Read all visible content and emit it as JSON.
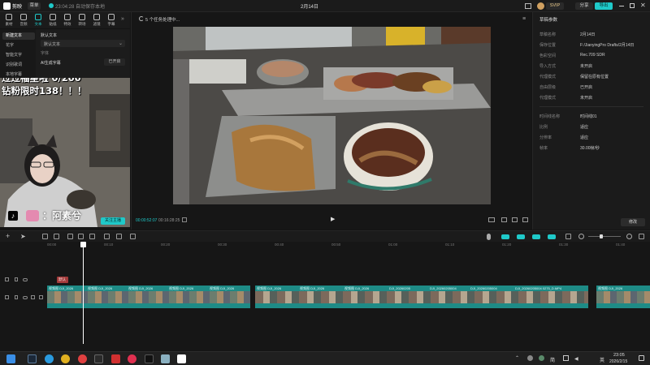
{
  "app": {
    "name": "剪映",
    "menu": "菜单",
    "autosave": "23:04:28 自动保存本地",
    "doc_title": "2月14日",
    "vip_badge": "SVIP",
    "share_label": "分享",
    "export_label": "导出"
  },
  "toolbar": {
    "items": [
      {
        "label": "素材",
        "icon": "media-icon"
      },
      {
        "label": "音频",
        "icon": "audio-icon"
      },
      {
        "label": "文本",
        "icon": "text-icon"
      },
      {
        "label": "贴纸",
        "icon": "sticker-icon"
      },
      {
        "label": "特效",
        "icon": "effects-icon"
      },
      {
        "label": "转场",
        "icon": "transition-icon"
      },
      {
        "label": "滤镜",
        "icon": "filter-icon"
      },
      {
        "label": "字幕",
        "icon": "caption-icon"
      }
    ],
    "active_index": 2
  },
  "sidebar": {
    "items": [
      "新建文本",
      "花字",
      "智能文字",
      "识别歌词",
      "本地字幕"
    ],
    "active_index": 0
  },
  "text_panel": {
    "heading": "默认文本",
    "template_select": "默认文本",
    "font_label": "字体",
    "apply_label": "应用到全部",
    "ai_label": "AI生成字幕",
    "ai_dropdown": "已开启"
  },
  "overlay": {
    "caption_line1": "过过福星啦 0/200",
    "caption_line2": "钻粉限时138！！！",
    "user_name": "：阿素兮",
    "follow_label": "关注主播"
  },
  "player": {
    "task_label": "5 个任务处理中...",
    "current_time": "00:00:52:07",
    "total_time": "00:16:28:25"
  },
  "properties": {
    "title": "草稿参数",
    "rows": [
      {
        "key": "草稿名称",
        "value": "2月14日"
      },
      {
        "key": "保存位置",
        "value": "F:/JianyingPro Drafts/2月14日"
      },
      {
        "key": "色彩空间",
        "value": "Rec.709 SDR"
      },
      {
        "key": "导入方式",
        "value": "未开启"
      },
      {
        "key": "代理模式",
        "value": "保留在原有位置"
      },
      {
        "key": "自由层级",
        "value": "已开启"
      },
      {
        "key": "代理模式",
        "value": "未开启"
      },
      {
        "key": "时间线名称",
        "value": "时间线01"
      },
      {
        "key": "比例",
        "value": "适应"
      },
      {
        "key": "分辨率",
        "value": "适应"
      },
      {
        "key": "帧率",
        "value": "30.00帧/秒"
      }
    ],
    "edit_label": "修改"
  },
  "timeline": {
    "ruler_labels": [
      "00:00",
      "00:10",
      "00:20",
      "00:30",
      "00:40",
      "00:50",
      "01:00",
      "01:10",
      "01:20",
      "01:30",
      "01:40"
    ],
    "text_clip": "默认",
    "clip_labels": [
      "视频图 DJI_2026",
      "视频图 DJI_2026",
      "视频图 DJI_2026",
      "视频图 DJI_2026",
      "视频图 DJI_2026",
      "视频图 DJI_2026",
      "视频图 DJI_2026",
      "视频图 DJI_2026",
      "DJI_20260205",
      "DJI_20260205004",
      "DJI_20260205004",
      "DJI_20260205004 0275_D.MP4",
      "视频图 DJI_2026"
    ]
  },
  "taskbar": {
    "time": "23:05",
    "date": "2026/2/15",
    "lang": "英",
    "ime": "简"
  },
  "colors": {
    "accent": "#1fc9c9",
    "clip": "#1e8b86",
    "playhead": "#ffffff",
    "text_clip": "#a33a3a"
  }
}
